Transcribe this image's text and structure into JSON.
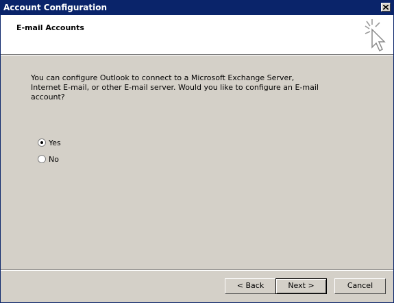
{
  "window": {
    "title": "Account Configuration",
    "close_icon": "close-icon"
  },
  "header": {
    "title": "E-mail Accounts",
    "icon": "wizard-pointer-icon"
  },
  "main": {
    "prompt": "You can configure Outlook to connect to a Microsoft Exchange Server, Internet E-mail, or other E-mail server.  Would you like to configure an E-mail account?",
    "options": [
      {
        "label": "Yes",
        "selected": true
      },
      {
        "label": "No",
        "selected": false
      }
    ]
  },
  "footer": {
    "back_label": "< Back",
    "next_label": "Next >",
    "cancel_label": "Cancel"
  },
  "colors": {
    "titlebar": "#0a246a",
    "dialog": "#d4d0c8",
    "header": "#ffffff"
  }
}
